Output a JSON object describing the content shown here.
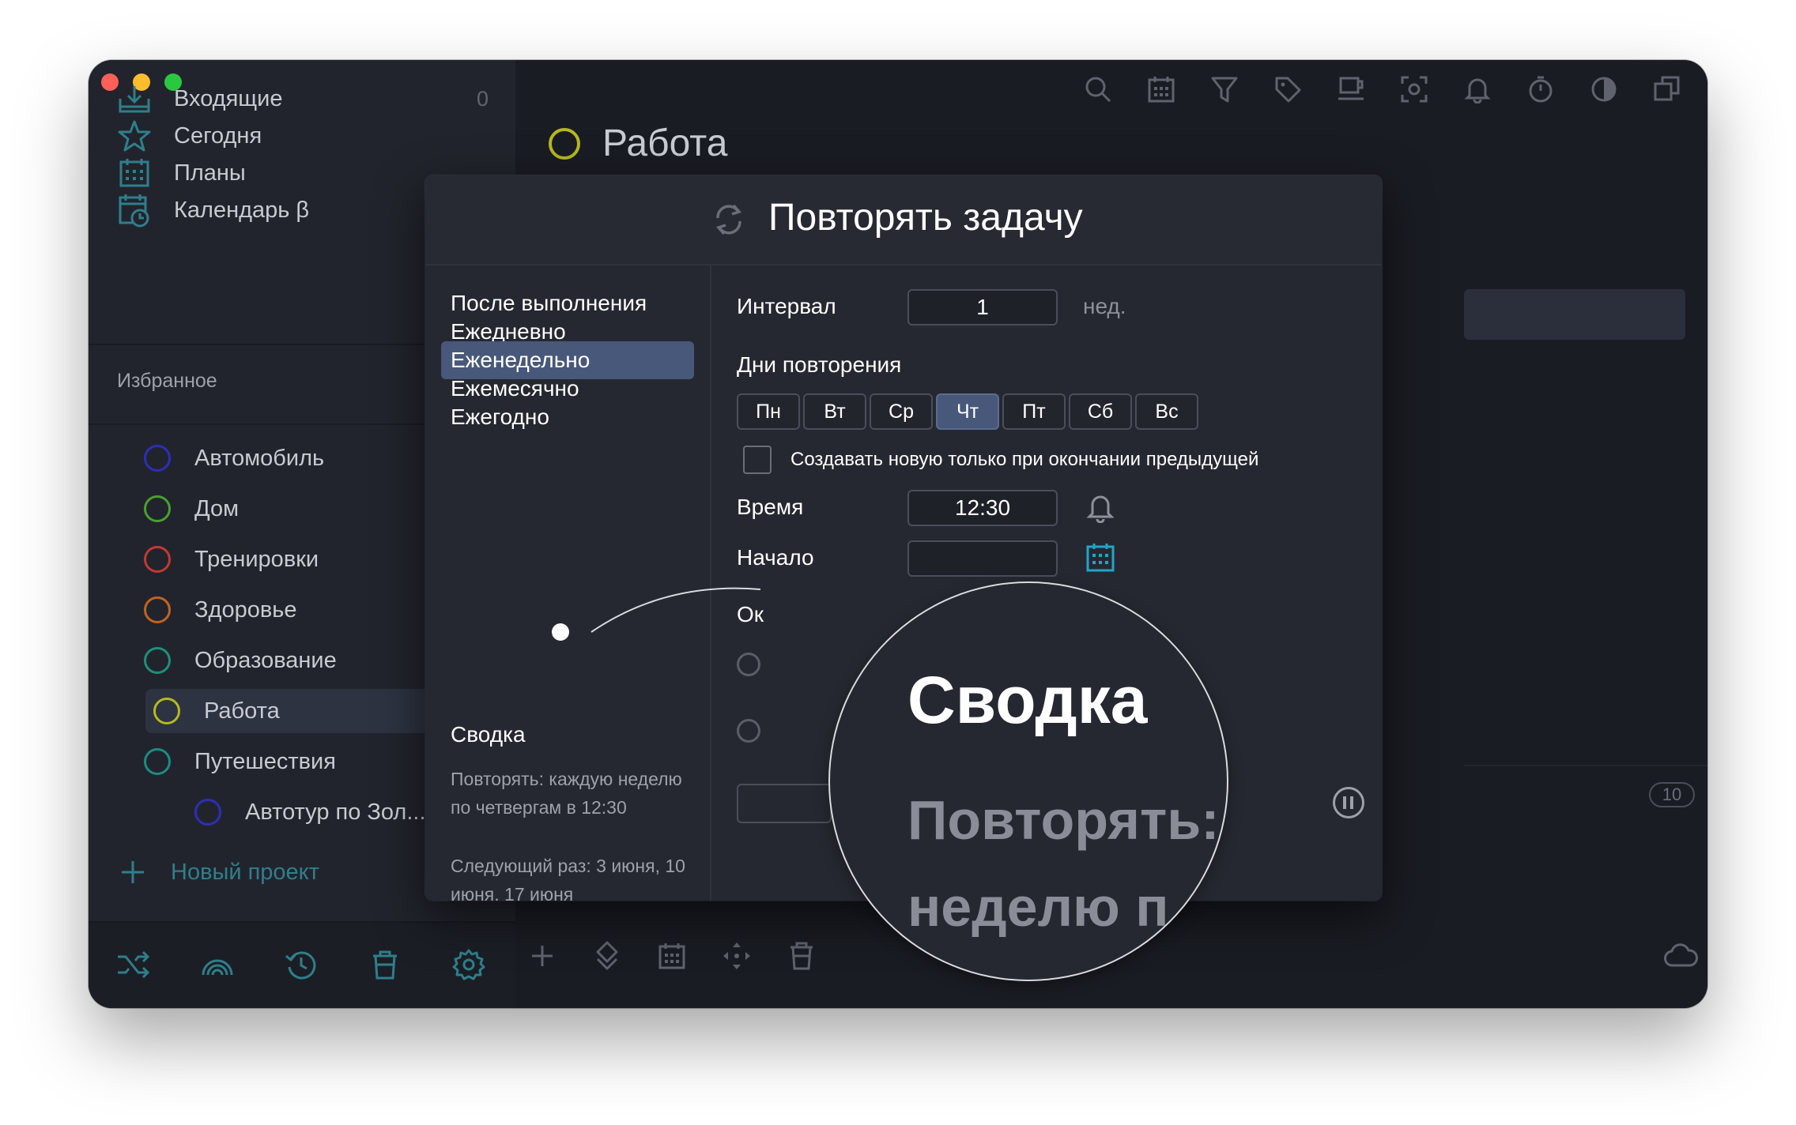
{
  "sidebar": {
    "nav": [
      {
        "label": "Входящие",
        "count": "0",
        "icon": "inbox-icon"
      },
      {
        "label": "Сегодня",
        "icon": "star-icon"
      },
      {
        "label": "Планы",
        "icon": "calendar-grid-icon"
      },
      {
        "label": "Календарь β",
        "icon": "calendar-clock-icon"
      }
    ],
    "favorites_title": "Избранное",
    "projects": [
      {
        "label": "Автомобиль",
        "color": "#2c2fb8"
      },
      {
        "label": "Дом",
        "color": "#49a02e"
      },
      {
        "label": "Тренировки",
        "color": "#c23a2e"
      },
      {
        "label": "Здоровье",
        "color": "#c2631e"
      },
      {
        "label": "Образование",
        "color": "#1f8f7a"
      },
      {
        "label": "Работа",
        "color": "#b6b81f"
      },
      {
        "label": "Путешествия",
        "color": "#1c8c82"
      },
      {
        "label": "Автотур по Зол...",
        "color": "#2c2fb8"
      }
    ],
    "new_project": "Новый проект",
    "bottom_icons": [
      "shuffle-icon",
      "rainbow-icon",
      "history-icon",
      "trash-icon",
      "settings-icon"
    ]
  },
  "main": {
    "title": "Работа",
    "badge": "10",
    "toolbar_icons": [
      "search-icon",
      "calendar-icon",
      "filter-icon",
      "tag-icon",
      "coffee-icon",
      "focus-icon",
      "bell-icon",
      "timer-icon",
      "contrast-icon",
      "windows-icon"
    ]
  },
  "modal": {
    "title": "Повторять задачу",
    "frequencies": [
      "После выполнения",
      "Ежедневно",
      "Еженедельно",
      "Ежемесячно",
      "Ежегодно"
    ],
    "selected_frequency": "Еженедельно",
    "interval_label": "Интервал",
    "interval_value": "1",
    "interval_unit": "нед.",
    "days_label": "Дни повторения",
    "days": [
      "Пн",
      "Вт",
      "Ср",
      "Чт",
      "Пт",
      "Сб",
      "Вс"
    ],
    "selected_day": "Чт",
    "checkbox_label": "Создавать новую только при окончании предыдущей",
    "time_label": "Время",
    "time_value": "12:30",
    "start_label": "Начало",
    "end_label_partial": "Ок",
    "summary_title": "Сводка",
    "summary_text": "Повторять: каждую неделю по четвергам в 12:30",
    "next_text": "Следующий раз: 3 июня, 10 июня, 17 июня"
  },
  "magnifier": {
    "title": "Сводка",
    "line1": "Повторять:",
    "line2": "неделю п"
  },
  "colors": {
    "accent": "#48587a",
    "teal": "#2f7f8a"
  }
}
